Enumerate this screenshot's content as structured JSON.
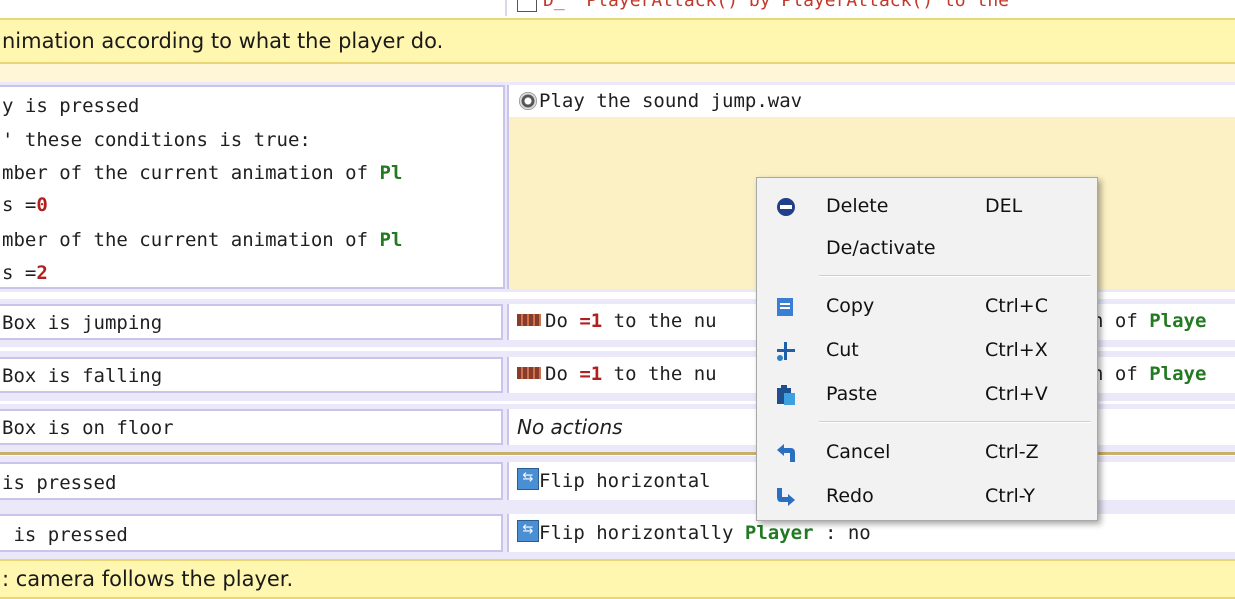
{
  "top_line": {
    "text": "D_  PlayerAttack() by PlayerAttack() to the"
  },
  "comments": [
    {
      "text": "nimation according to what the player do."
    },
    {
      "text": ": camera follows the player."
    }
  ],
  "events": {
    "jump_condition": {
      "lines": [
        "y is pressed",
        "' these conditions is true:",
        "mber of the current animation of ",
        "s =",
        "mber of the current animation of ",
        "s ="
      ],
      "obj1": "Pl",
      "val1": "0",
      "obj2": "Pl",
      "val2": "2"
    },
    "jump_action": "Play the sound jump.wav",
    "rows": [
      {
        "cond": "Box is jumping",
        "action_prefix": "Do ",
        "action_value": "=1",
        "action_mid": " to the nu",
        "action_tail": "n of ",
        "action_obj": "Playe"
      },
      {
        "cond": "Box is falling",
        "action_prefix": "Do ",
        "action_value": "=1",
        "action_mid": " to the nu",
        "action_tail": "n of ",
        "action_obj": "Playe"
      },
      {
        "cond": "Box is on floor",
        "action_empty": "No actions"
      },
      {
        "cond": "is pressed",
        "flip_text": "Flip horizontal"
      },
      {
        "cond": " is pressed",
        "flip_text": "Flip horizontally ",
        "flip_obj": "Player",
        "flip_tail": " : no"
      }
    ]
  },
  "context_menu": {
    "items": [
      {
        "icon": "delete-icon",
        "label": "Delete",
        "shortcut": "DEL"
      },
      {
        "icon": "",
        "label": "De/activate",
        "shortcut": ""
      },
      {
        "icon": "copy-icon",
        "label": "Copy",
        "shortcut": "Ctrl+C"
      },
      {
        "icon": "cut-icon",
        "label": "Cut",
        "shortcut": "Ctrl+X"
      },
      {
        "icon": "paste-icon",
        "label": "Paste",
        "shortcut": "Ctrl+V"
      },
      {
        "icon": "undo-icon",
        "label": "Cancel",
        "shortcut": "Ctrl-Z"
      },
      {
        "icon": "redo-icon",
        "label": "Redo",
        "shortcut": "Ctrl-Y"
      }
    ]
  },
  "colors": {
    "comment_bg": "#fff6b0",
    "event_bg": "#ebe9f9",
    "object_name": "#237a23",
    "number_value": "#b02020",
    "menu_bg": "#f2f2f2"
  }
}
